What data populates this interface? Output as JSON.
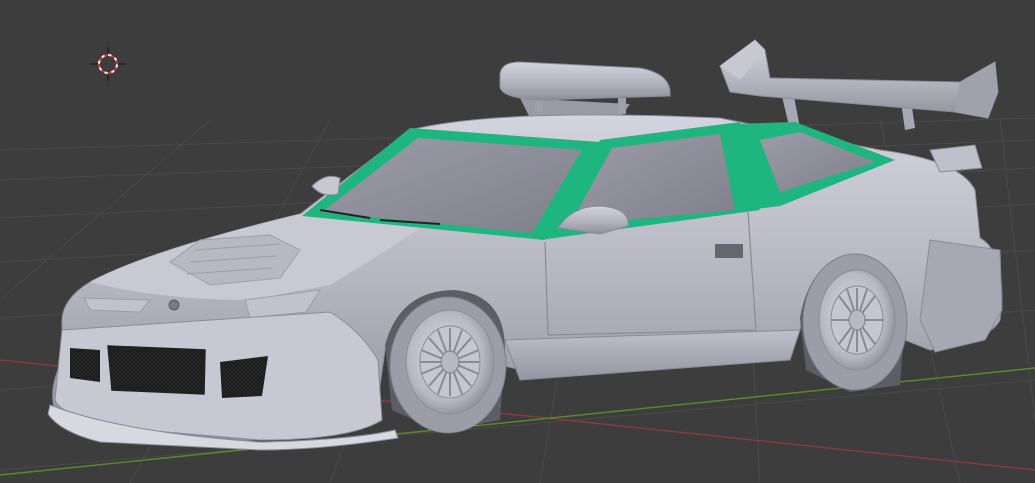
{
  "viewport": {
    "background_color": "#3d3d3d",
    "grid_color": "#4a4a4a",
    "x_axis_color": "#8a3a3a",
    "y_axis_color": "#5b8a2a"
  },
  "scene": {
    "object": "car-model",
    "body_color": "#b4b4bf",
    "body_shadow_color": "#9a9aa6",
    "body_highlight_color": "#d2d2dc",
    "selection_color": "#1fb57e",
    "glass_color": "#8e8e99",
    "grille_color": "#1a1a1a",
    "cursor_icon": "3d-cursor-icon"
  }
}
